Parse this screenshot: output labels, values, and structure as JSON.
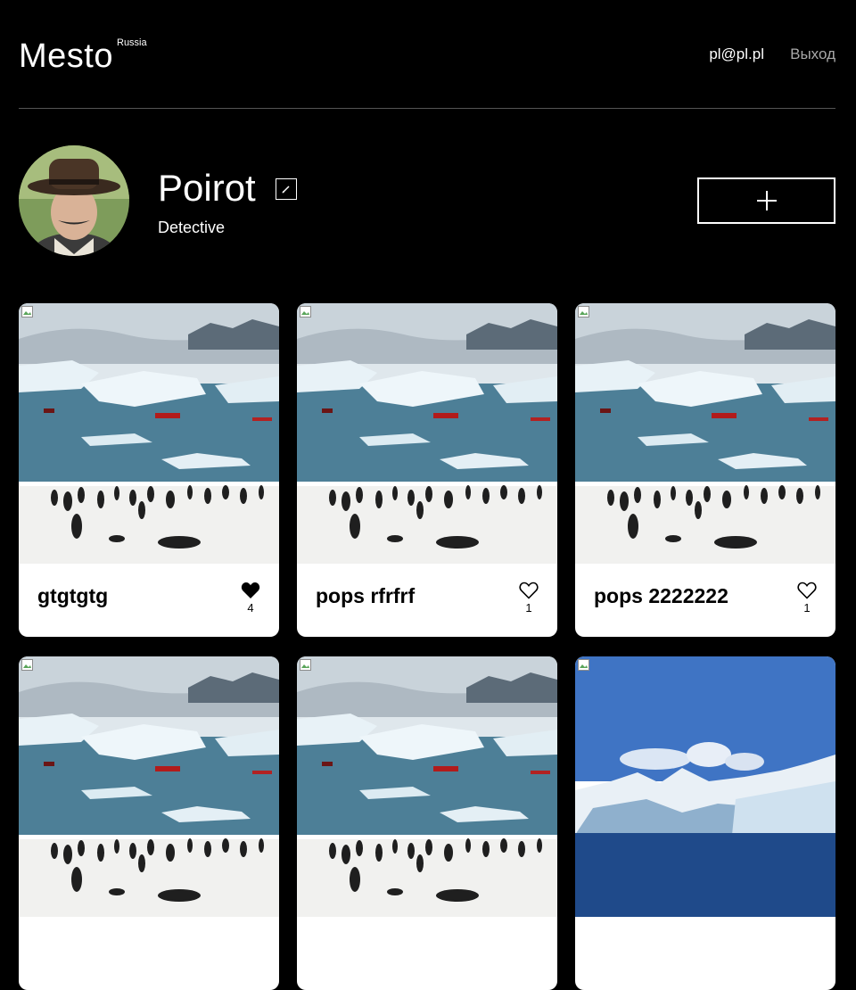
{
  "header": {
    "logo": "Mesto",
    "logo_sup": "Russia",
    "email": "pl@pl.pl",
    "logout": "Выход"
  },
  "profile": {
    "name": "Poirot",
    "about": "Detective"
  },
  "cards": [
    {
      "title": "gtgtgtg",
      "likes": "4",
      "liked": true,
      "image": "penguins"
    },
    {
      "title": "pops rfrfrf",
      "likes": "1",
      "liked": false,
      "image": "penguins"
    },
    {
      "title": "pops 2222222",
      "likes": "1",
      "liked": false,
      "image": "penguins"
    },
    {
      "title": "",
      "likes": "",
      "liked": false,
      "image": "penguins"
    },
    {
      "title": "",
      "likes": "",
      "liked": false,
      "image": "penguins"
    },
    {
      "title": "",
      "likes": "",
      "liked": false,
      "image": "glacier"
    }
  ],
  "colors": {
    "background": "#000000",
    "card": "#ffffff",
    "muted_text": "#a9a9a9",
    "divider": "#545454"
  }
}
